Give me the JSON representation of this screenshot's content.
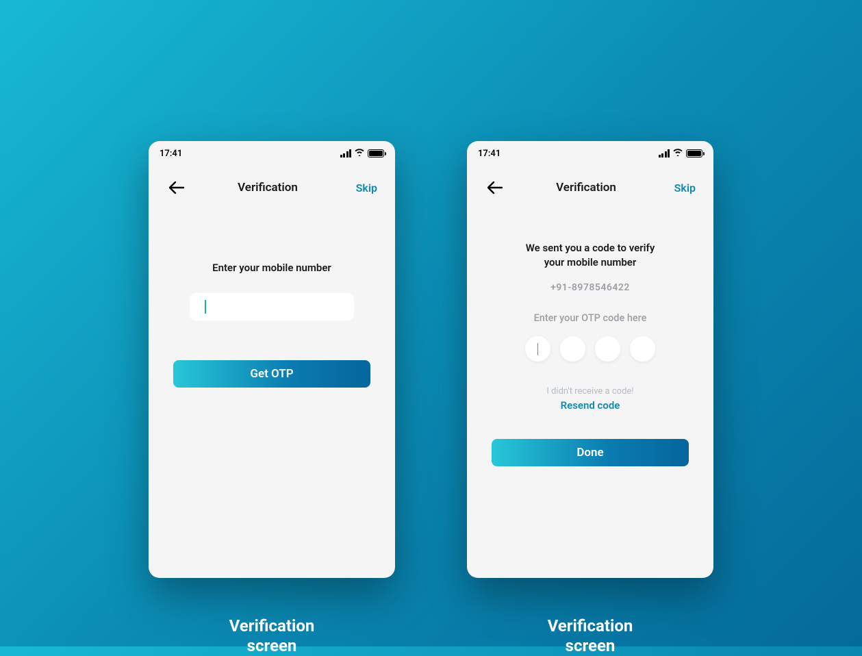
{
  "status": {
    "time": "17:41"
  },
  "nav": {
    "title": "Verification",
    "skip": "Skip"
  },
  "screen1": {
    "prompt": "Enter your mobile number",
    "button": "Get OTP"
  },
  "screen2": {
    "heading_line1": "We sent you a code to verify",
    "heading_line2": "your mobile number",
    "phone_number": "+91-8978546422",
    "otp_label": "Enter your OTP code here",
    "no_code": "I didn't receive a code!",
    "resend": "Resend code",
    "button": "Done"
  },
  "captions": {
    "left_line1": "Verification",
    "left_line2": "screen",
    "right_line1": "Verification",
    "right_line2": "screen"
  },
  "colors": {
    "accent": "#118ab2",
    "gradient_start": "#27c7d8",
    "gradient_end": "#05669d"
  }
}
